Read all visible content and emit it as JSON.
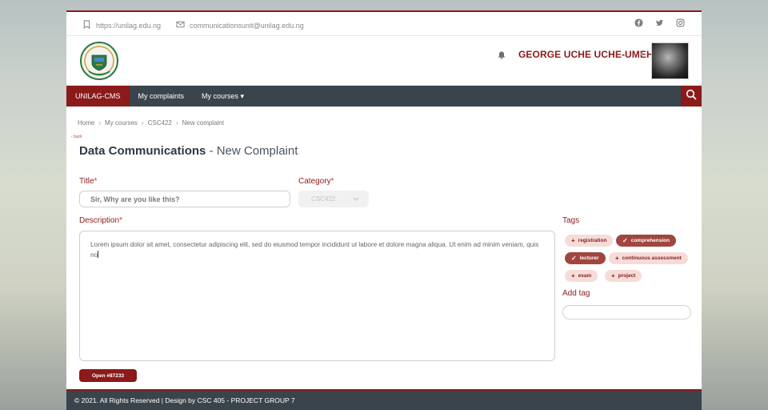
{
  "topbar": {
    "website": "https://unilag.edu.ng",
    "email": "communicationsunit@unilag.edu.ng",
    "social": [
      "facebook-icon",
      "twitter-icon",
      "instagram-icon"
    ]
  },
  "header": {
    "user_name": "GEORGE UCHE UCHE-UMEH",
    "user_caret": "▾"
  },
  "nav": {
    "brand": "UNILAG-CMS",
    "items": [
      "My complaints",
      "My courses ▾"
    ]
  },
  "breadcrumb": [
    "Home",
    "My courses",
    "CSC422",
    "New complaint"
  ],
  "back_link": "‹ back",
  "page_title": {
    "course": "Data Communications",
    "suffix": " - New Complaint"
  },
  "form": {
    "title_label": "Title",
    "title_value": "Sir, Why are you like this?",
    "category_label": "Category",
    "category_value": "CSC422",
    "description_label": "Description",
    "description_value": "Lorem ipsum dolor sit amet, consectetur adipiscing elit, sed do eiusmod tempor incididunt ut labore et dolore magna aliqua. Ut enim ad minim veniam, quis no",
    "required_mark": "*",
    "submit_label": "Open #87233"
  },
  "tags": {
    "label": "Tags",
    "items": [
      {
        "name": "registration",
        "selected": false
      },
      {
        "name": "comprehension",
        "selected": true
      },
      {
        "name": "lecturer",
        "selected": true
      },
      {
        "name": "continuous assessment",
        "selected": false
      },
      {
        "name": "exam",
        "selected": false
      },
      {
        "name": "project",
        "selected": false
      }
    ],
    "add_label": "Add tag"
  },
  "footer": {
    "text": "© 2021. All Rights Reserved | Design by ",
    "credit": "CSC 405 - PROJECT GROUP 7"
  },
  "colors": {
    "brand": "#8b1a1a",
    "nav": "#3a444c",
    "tag_bg": "#f5dcd9",
    "tag_selected": "#a0463f"
  }
}
